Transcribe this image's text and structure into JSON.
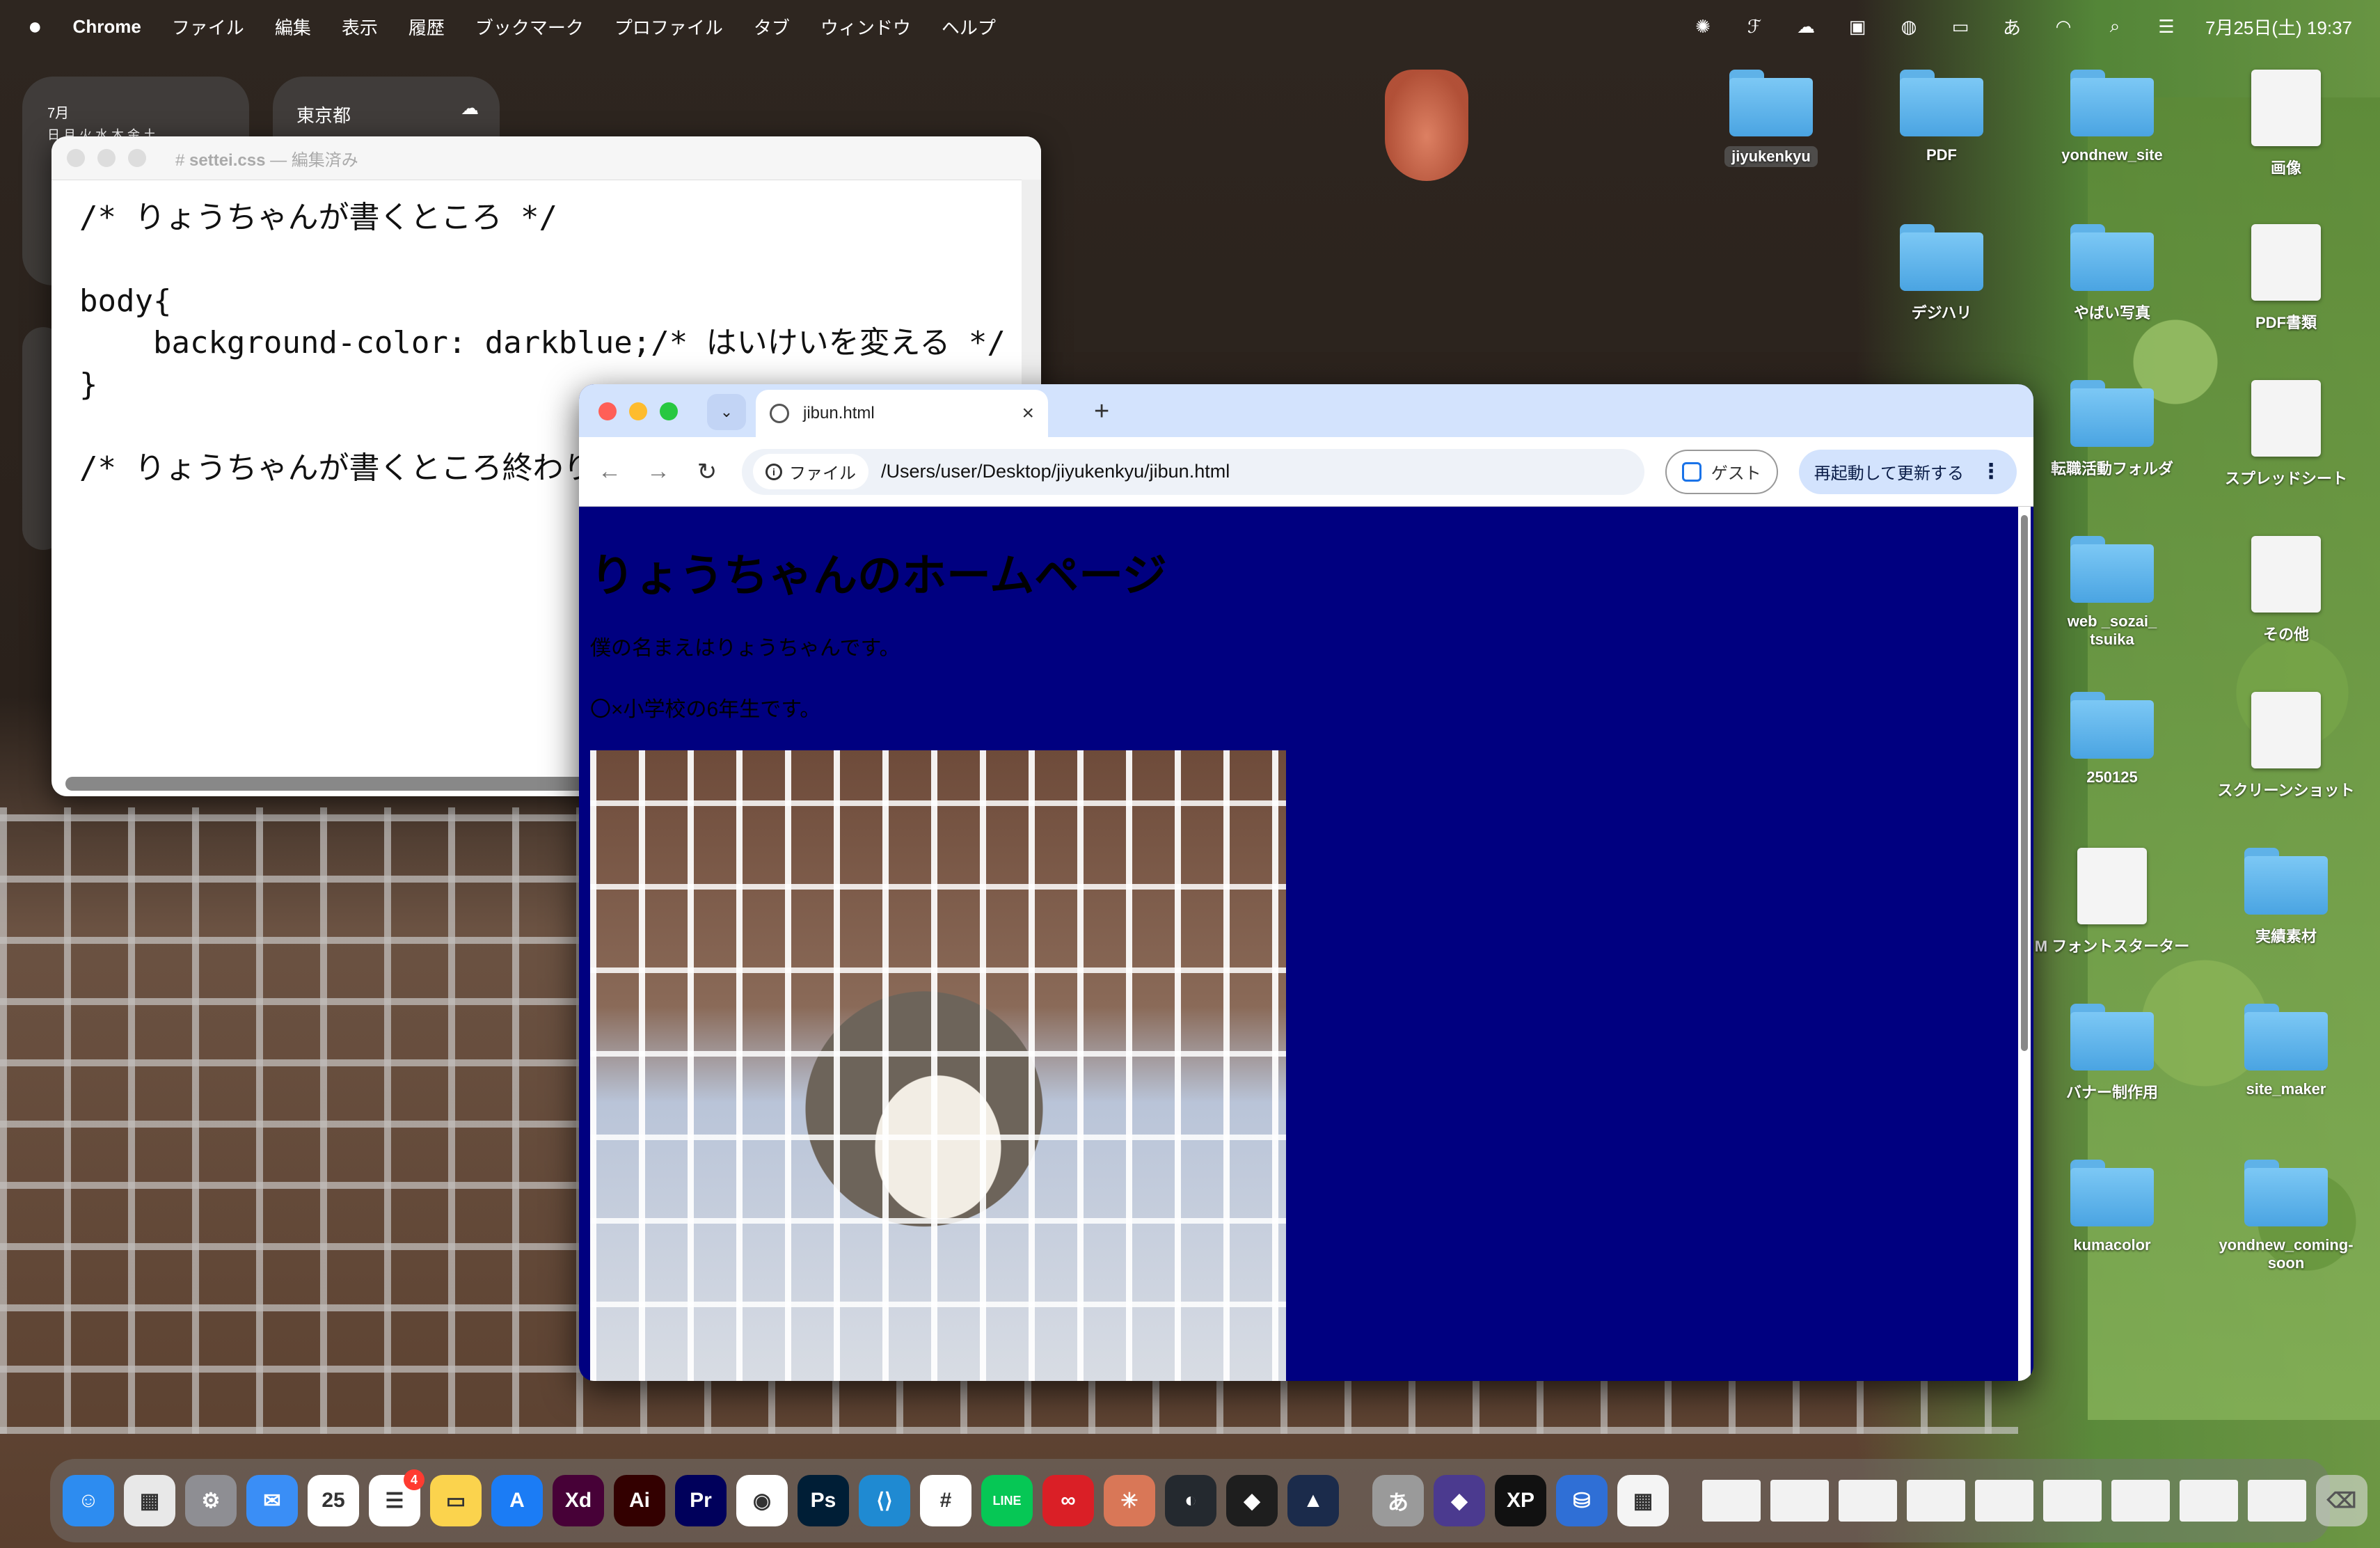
{
  "menubar": {
    "app_name": "Chrome",
    "menus": [
      "ファイル",
      "編集",
      "表示",
      "履歴",
      "ブックマーク",
      "プロファイル",
      "タブ",
      "ウィンドウ",
      "ヘルプ"
    ],
    "status_icons": [
      "ai-sparkle-icon",
      "figma-icon",
      "cloud-sync-icon",
      "xp-pen-icon",
      "line-icon",
      "battery-icon",
      "input-method-icon",
      "wifi-icon",
      "spotlight-search-icon",
      "control-center-icon"
    ],
    "input_method_label": "あ",
    "clock": "7月25日(土) 19:37"
  },
  "widgets": {
    "calendar_month": "7月",
    "calendar_weekdays": "日 月 火 水 木 金 土",
    "weather_location": "東京都"
  },
  "textedit": {
    "title": "settei.css",
    "subtitle": "— 編集済み",
    "code_lines": [
      "/* りょうちゃんが書くところ */",
      "",
      "body{",
      "    background-color: darkblue;/* はいけいを変える */",
      "}",
      "",
      "/* りょうちゃんが書くところ終わり */"
    ]
  },
  "chrome": {
    "tab_title": "jibun.html",
    "new_tab_symbol": "+",
    "tab_close_symbol": "×",
    "chip_label": "ファイル",
    "url": "/Users/user/Desktop/jiyukenkyu/jibun.html",
    "guest_label": "ゲスト",
    "relaunch_label": "再起動して更新する",
    "page_bg_color": "#000080",
    "page": {
      "heading": "りょうちゃんのホームページ",
      "para1": "僕の名まえはりょうちゃんです。",
      "para2": "〇×小学校の6年生です。"
    }
  },
  "desktop_icons": [
    {
      "label": "jiyukenkyu",
      "type": "folder",
      "selected": true
    },
    {
      "label": "PDF",
      "type": "folder"
    },
    {
      "label": "yondnew_site",
      "type": "folder"
    },
    {
      "label": "画像",
      "type": "app"
    },
    {
      "label": "デジハリ",
      "type": "folder"
    },
    {
      "label": "やばい写真",
      "type": "folder"
    },
    {
      "label": "PDF書類",
      "type": "doc"
    },
    {
      "label": "転職活動フォルダ",
      "type": "folder"
    },
    {
      "label": "スプレッドシート",
      "type": "doc"
    },
    {
      "label": "web _sozai_\ntsuika",
      "type": "folder"
    },
    {
      "label": "その他",
      "type": "doc"
    },
    {
      "label": "250125",
      "type": "folder"
    },
    {
      "label": "スクリーンショット",
      "type": "doc"
    },
    {
      "label": "M フォントスターター",
      "type": "app"
    },
    {
      "label": "実績素材",
      "type": "folder"
    },
    {
      "label": "バナー制作用",
      "type": "folder"
    },
    {
      "label": "site_maker",
      "type": "folder"
    },
    {
      "label": "kumacolor",
      "type": "folder"
    },
    {
      "label": "yondnew_coming-\nsoon",
      "type": "folder"
    }
  ],
  "dock": {
    "apps": [
      {
        "name": "finder-icon",
        "text": "☺",
        "color": "#2d8cf0"
      },
      {
        "name": "launchpad-icon",
        "text": "▦",
        "color": "#e8e8e8"
      },
      {
        "name": "system-settings-icon",
        "text": "⚙",
        "color": "#8e8e93"
      },
      {
        "name": "mail-icon",
        "text": "✉",
        "color": "#3a8ef6"
      },
      {
        "name": "calendar-icon",
        "text": "25",
        "color": "#ffffff"
      },
      {
        "name": "reminders-icon",
        "text": "☰",
        "color": "#ffffff",
        "badge": "4"
      },
      {
        "name": "notes-icon",
        "text": "▭",
        "color": "#fbd34d"
      },
      {
        "name": "app-store-icon",
        "text": "A",
        "color": "#1b7cf5"
      },
      {
        "name": "adobe-xd-icon",
        "text": "Xd",
        "color": "#470137"
      },
      {
        "name": "illustrator-icon",
        "text": "Ai",
        "color": "#330000"
      },
      {
        "name": "premiere-icon",
        "text": "Pr",
        "color": "#00005b"
      },
      {
        "name": "chrome-icon",
        "text": "◉",
        "color": "#ffffff"
      },
      {
        "name": "photoshop-icon",
        "text": "Ps",
        "color": "#001e36"
      },
      {
        "name": "vscode-icon",
        "text": "⟨⟩",
        "color": "#1f8ad2"
      },
      {
        "name": "slack-icon",
        "text": "#",
        "color": "#ffffff"
      },
      {
        "name": "line-icon",
        "text": "LINE",
        "color": "#06c755"
      },
      {
        "name": "creative-cloud-icon",
        "text": "∞",
        "color": "#da1f26"
      },
      {
        "name": "claude-icon",
        "text": "✳",
        "color": "#d97757"
      },
      {
        "name": "github-icon",
        "text": "◐",
        "color": "#24292f"
      },
      {
        "name": "figma-icon",
        "text": "◆",
        "color": "#1e1e1e"
      },
      {
        "name": "affinity-icon",
        "text": "▲",
        "color": "#1b2b4b"
      }
    ],
    "apps_after_sep": [
      {
        "name": "input-method-app-icon",
        "text": "あ",
        "color": "#9a9a9a"
      },
      {
        "name": "cursor-app-icon",
        "text": "◆",
        "color": "#4b3a8f"
      },
      {
        "name": "xp-pen-app-icon",
        "text": "XP",
        "color": "#111111"
      },
      {
        "name": "database-app-icon",
        "text": "⛁",
        "color": "#2f6fd6"
      },
      {
        "name": "grid-app-icon",
        "text": "▦",
        "color": "#f4f4f4"
      }
    ],
    "thumbnail_count": 9,
    "trash": "trash-icon"
  }
}
